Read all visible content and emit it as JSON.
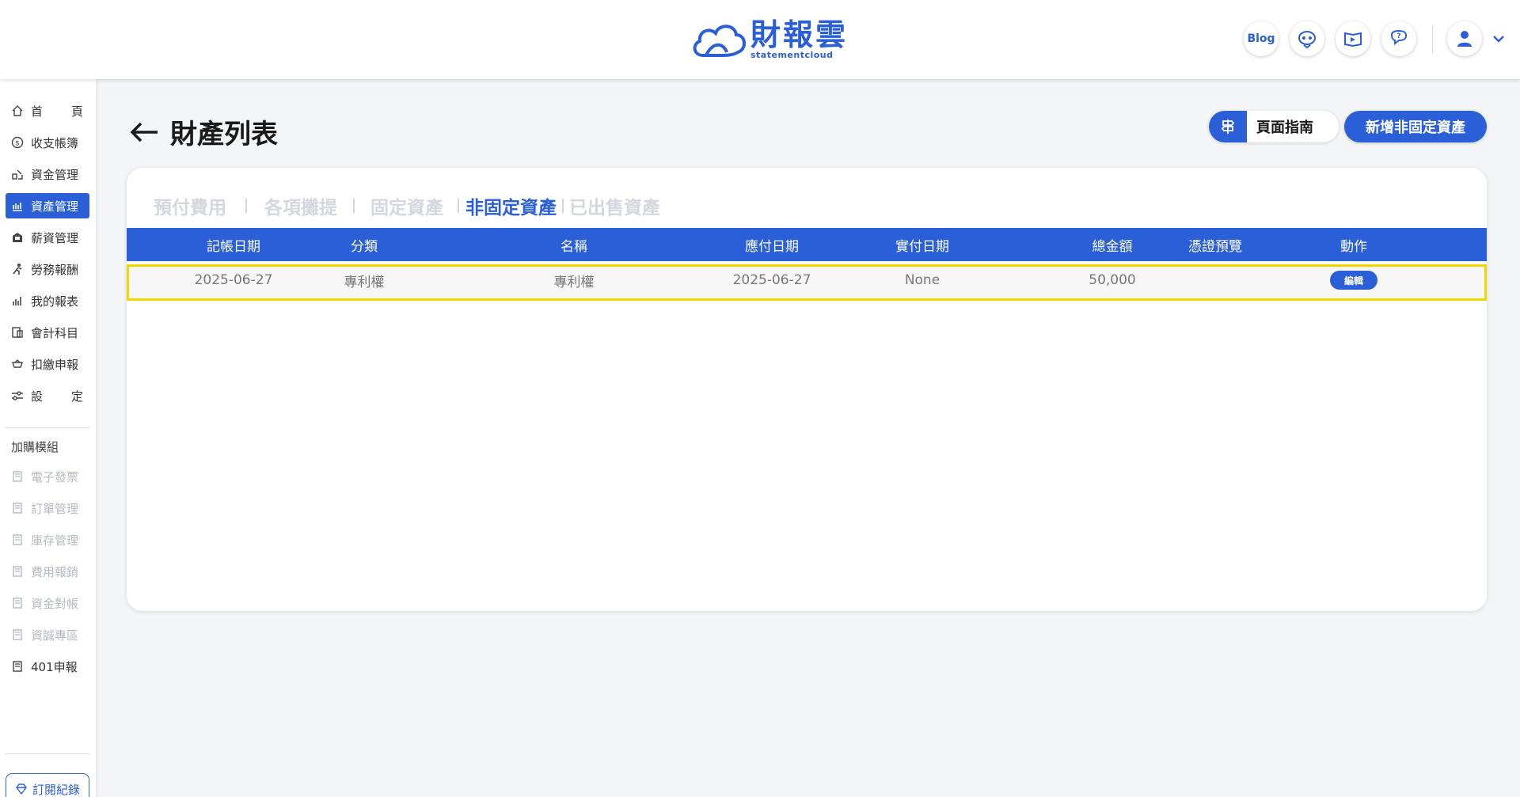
{
  "header": {
    "logo_cn": "財報雲",
    "logo_en": "statementcloud",
    "blog_label": "Blog"
  },
  "sidebar": {
    "items": [
      {
        "label": "首　　頁",
        "icon": "home-icon",
        "spread": true
      },
      {
        "label": "收支帳簿",
        "icon": "coin-icon"
      },
      {
        "label": "資金管理",
        "icon": "funds-icon"
      },
      {
        "label": "資產管理",
        "icon": "assets-icon",
        "active": true
      },
      {
        "label": "薪資管理",
        "icon": "salary-icon"
      },
      {
        "label": "勞務報酬",
        "icon": "labor-icon"
      },
      {
        "label": "我的報表",
        "icon": "bar-chart-icon"
      },
      {
        "label": "會計科目",
        "icon": "ledger-icon"
      },
      {
        "label": "扣繳申報",
        "icon": "withholding-icon"
      },
      {
        "label": "設　　定",
        "icon": "settings-icon",
        "spread": true
      }
    ],
    "addon_heading": "加購模組",
    "addons": [
      {
        "label": "電子發票",
        "muted": true
      },
      {
        "label": "訂單管理",
        "muted": true
      },
      {
        "label": "庫存管理",
        "muted": true
      },
      {
        "label": "費用報銷",
        "muted": true
      },
      {
        "label": "資金對帳",
        "muted": true
      },
      {
        "label": "資誠專區",
        "muted": true
      },
      {
        "label": "401申報",
        "muted": false
      }
    ],
    "subscription_label": "訂閱紀錄"
  },
  "main": {
    "title": "財產列表",
    "guide_label": "頁面指南",
    "add_label": "新增非固定資產",
    "tabs": [
      {
        "label": "預付費用"
      },
      {
        "label": "各項攤提"
      },
      {
        "label": "固定資產"
      },
      {
        "label": "非固定資產",
        "active": true
      },
      {
        "label": "已出售資產"
      }
    ],
    "table": {
      "columns": [
        "記帳日期",
        "分類",
        "名稱",
        "應付日期",
        "實付日期",
        "總金額",
        "憑證預覽",
        "動作"
      ],
      "rows": [
        {
          "record_date": "2025-06-27",
          "category": "專利權",
          "name": "專利權",
          "due_date": "2025-06-27",
          "paid_date": "None",
          "total": "50,000",
          "voucher": "",
          "action": "編輯"
        }
      ]
    }
  },
  "colors": {
    "accent": "#2b5fd8",
    "highlight": "#f3d500",
    "tab_inactive": "#d4d7de"
  }
}
